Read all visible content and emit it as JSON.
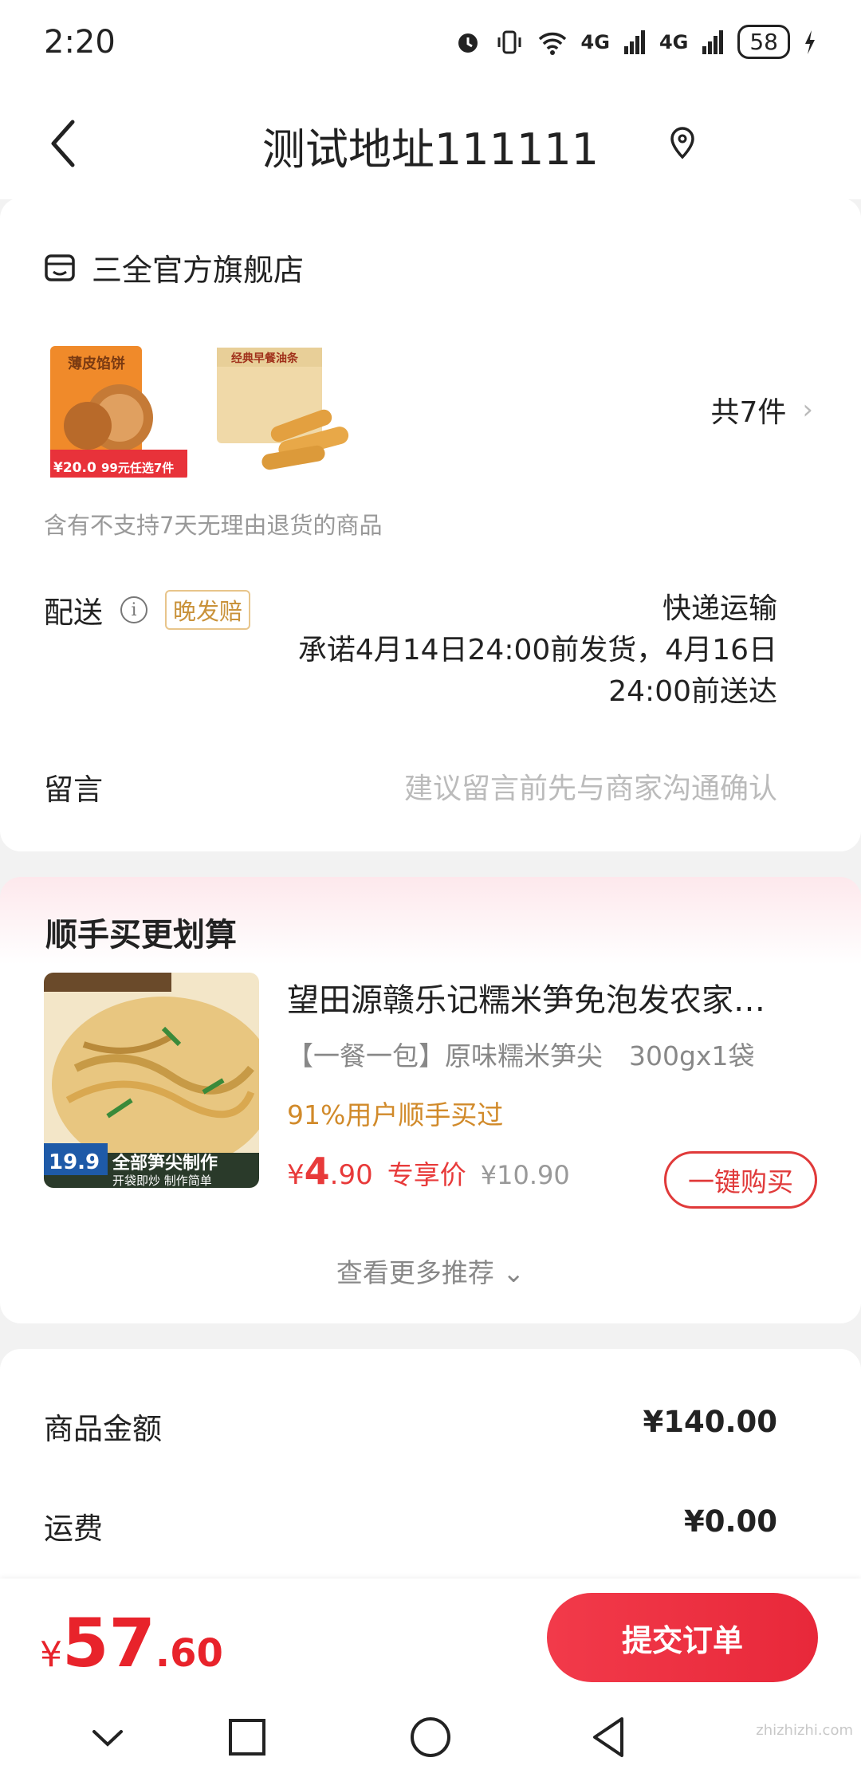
{
  "status_bar": {
    "time": "2:20",
    "network1": "4G",
    "network2": "4G",
    "battery": "58"
  },
  "nav": {
    "title": "测试地址111111"
  },
  "store": {
    "name": "三全官方旗舰店",
    "item_count": "共7件",
    "notice": "含有不支持7天无理由退货的商品",
    "product1": {
      "badge_price": "20.0",
      "promo": "99元任选7件",
      "label": "薄皮馅饼"
    },
    "product2": {
      "label": "经典早餐油条"
    }
  },
  "delivery": {
    "label": "配送",
    "badge": "晚发赔",
    "method": "快递运输",
    "promise_line1": "承诺4月14日24:00前发货，4月16日",
    "promise_line2": "24:00前送达"
  },
  "message": {
    "label": "留言",
    "placeholder": "建议留言前先与商家沟通确认"
  },
  "recommend": {
    "section_title": "顺手买更划算",
    "title": "望田源赣乐记糯米笋免泡发农家…",
    "spec": "【一餐一包】原味糯米笋尖　300gx1袋",
    "stat": "91%用户顺手买过",
    "price_symbol": "¥",
    "price_int": "4",
    "price_dec": ".90",
    "price_tag": "专享价",
    "original_price": "¥10.90",
    "buy_label": "一键购买",
    "more_label": "查看更多推荐",
    "img_price": "19.9",
    "img_caption1": "全部笋尖制作",
    "img_caption2": "开袋即炒 制作简单"
  },
  "summary": {
    "goods_label": "商品金额",
    "goods_value": "¥140.00",
    "shipping_label": "运费",
    "shipping_value": "¥0.00"
  },
  "bottom": {
    "total_symbol": "¥",
    "total_int": "57",
    "total_dec": ".60",
    "submit_label": "提交订单"
  },
  "watermark": "zhizhizhi.com",
  "colors": {
    "accent_red": "#e8232b",
    "gold": "#d18a2a"
  }
}
